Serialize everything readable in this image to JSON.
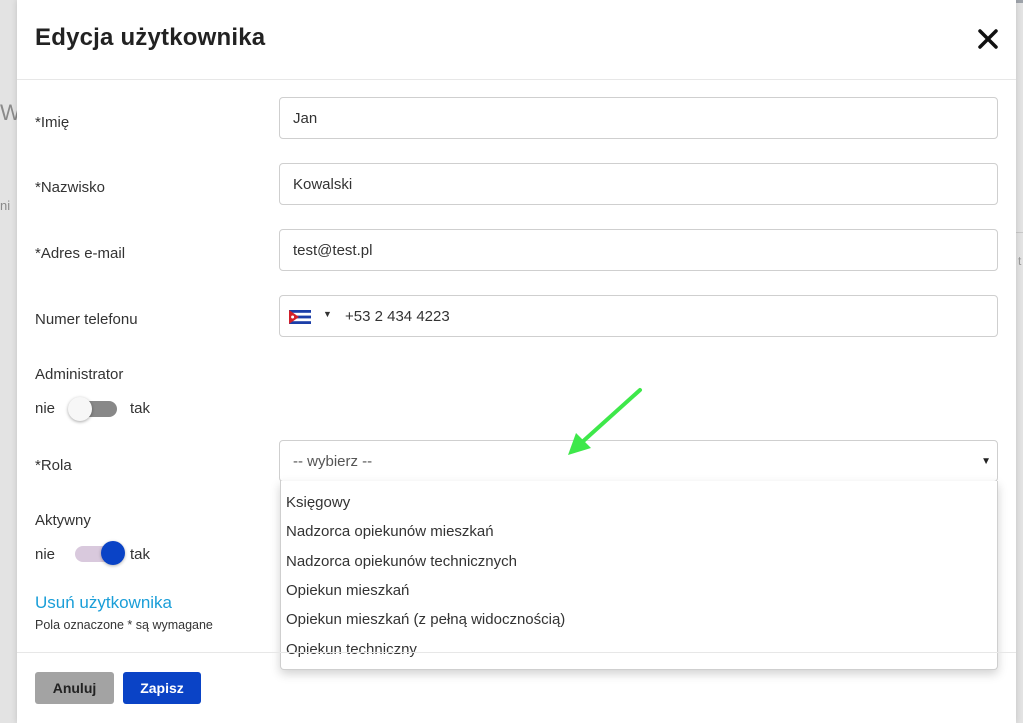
{
  "dialog": {
    "title": "Edycja użytkownika"
  },
  "fields": {
    "first_name": {
      "label": "*Imię",
      "value": "Jan"
    },
    "last_name": {
      "label": "*Nazwisko",
      "value": "Kowalski"
    },
    "email": {
      "label": "*Adres e-mail",
      "value": "test@test.pl"
    },
    "phone": {
      "label": "Numer telefonu",
      "country_flag": "cuba-flag-icon",
      "value": "+53 2 434 4223"
    }
  },
  "admin": {
    "label": "Administrator",
    "off_label": "nie",
    "on_label": "tak",
    "state": "off"
  },
  "role": {
    "label": "*Rola",
    "selected": "-- wybierz --",
    "options": [
      "Księgowy",
      "Nadzorca opiekunów mieszkań",
      "Nadzorca opiekunów technicznych",
      "Opiekun mieszkań",
      "Opiekun mieszkań (z pełną widocznością)",
      "Opiekun techniczny"
    ]
  },
  "active": {
    "label": "Aktywny",
    "off_label": "nie",
    "on_label": "tak",
    "state": "on"
  },
  "delete_link": "Usuń użytkownika",
  "required_note": "Pola oznaczone * są wymagane",
  "buttons": {
    "cancel": "Anuluj",
    "save": "Zapisz"
  },
  "background": {
    "partial_letter": "W",
    "partial_text": "ni",
    "partial_right": "t"
  },
  "colors": {
    "primary": "#0a43c6",
    "link": "#1a9ed8",
    "cancel": "#a3a3a3",
    "annotation_arrow": "#3ee84a"
  }
}
